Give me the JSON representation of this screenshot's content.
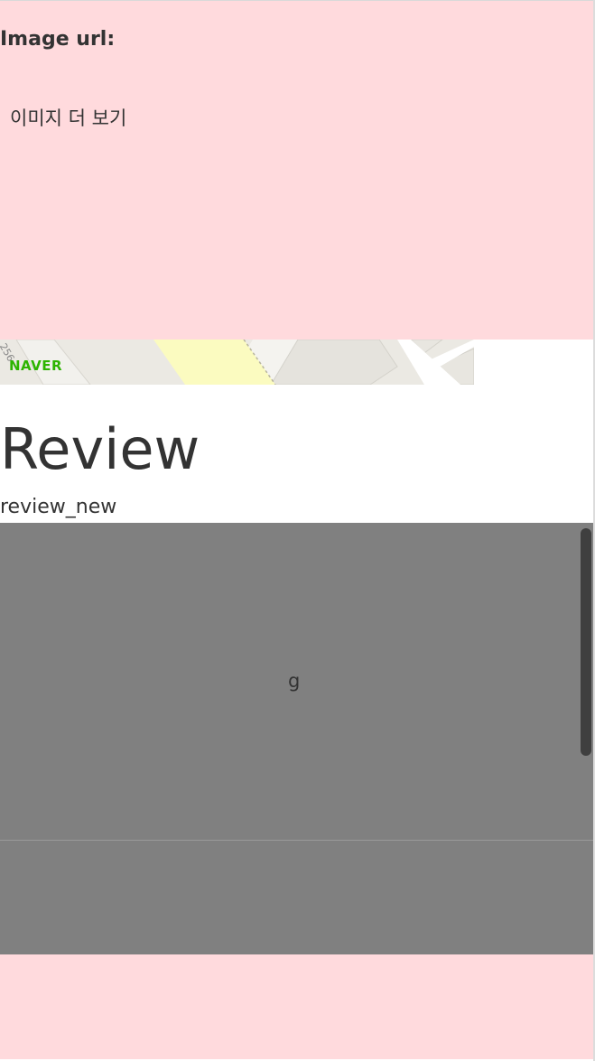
{
  "image_section": {
    "label": "Image url:",
    "more_images_link": "이미지 더 보기",
    "background_color": "#ffdadd"
  },
  "map": {
    "provider_logo": "NAVER",
    "street_label": "256",
    "logo_color": "#2db400"
  },
  "review": {
    "heading": "Review",
    "subheading": "review_new",
    "text": "g",
    "box_color": "#808080"
  }
}
